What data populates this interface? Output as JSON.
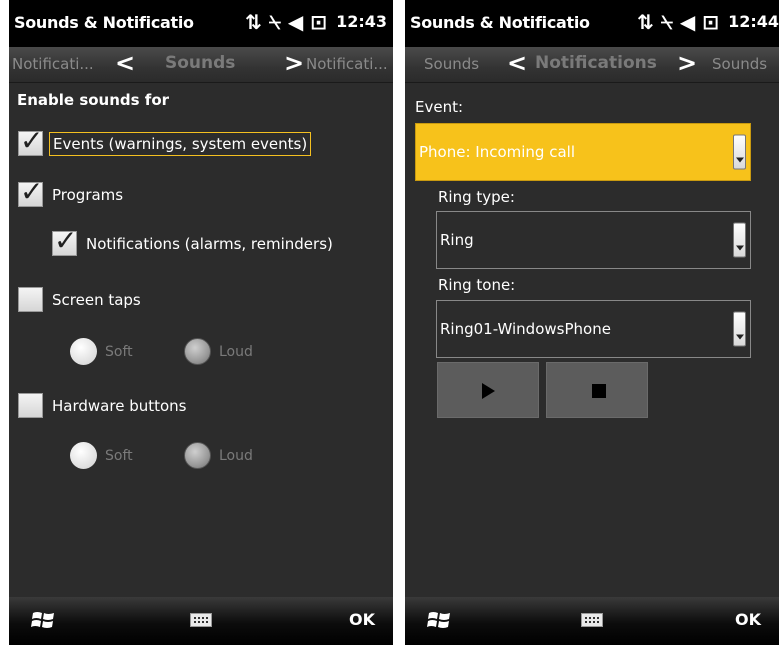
{
  "left": {
    "status": {
      "title": "Sounds & Notificatio",
      "time": "12:43"
    },
    "tabs": {
      "prev": "Notificati...",
      "current": "Sounds",
      "next": "Notificati..."
    },
    "heading": "Enable sounds for",
    "events_label": "Events (warnings, system events)",
    "programs_label": "Programs",
    "notifications_label": "Notifications (alarms, reminders)",
    "screen_taps_label": "Screen taps",
    "hardware_buttons_label": "Hardware buttons",
    "soft_label": "Soft",
    "loud_label": "Loud",
    "ok_label": "OK",
    "checks": {
      "events": true,
      "programs": true,
      "notifications": true,
      "screen_taps": false,
      "hardware_buttons": false
    }
  },
  "right": {
    "status": {
      "title": "Sounds & Notificatio",
      "time": "12:44"
    },
    "tabs": {
      "prev": "Sounds",
      "current": "Notifications",
      "next": "Sounds"
    },
    "event_label": "Event:",
    "event_value": "Phone: Incoming call",
    "ring_type_label": "Ring type:",
    "ring_type_value": "Ring",
    "ring_tone_label": "Ring tone:",
    "ring_tone_value": "Ring01-WindowsPhone",
    "ok_label": "OK"
  },
  "icons": [
    "sync-arrows-icon",
    "no-signal-icon",
    "speaker-icon",
    "battery-charging-icon",
    "chevron-left-icon",
    "chevron-right-icon",
    "windows-start-icon",
    "keyboard-icon",
    "play-icon",
    "stop-icon",
    "checkmark-icon"
  ],
  "colors": {
    "accent": "#f7c21b",
    "background": "#2c2c2c",
    "statusbar": "#000000"
  }
}
